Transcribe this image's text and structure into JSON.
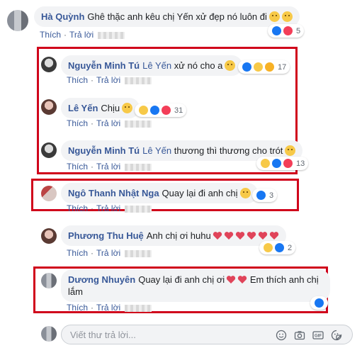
{
  "actions": {
    "like": "Thích",
    "reply": "Trả lời",
    "dot": "·"
  },
  "comments": [
    {
      "name": "Hà Quỳnh",
      "text": "Ghê thặc anh kêu chị Yến xử đẹp nó luôn đi",
      "reaction_count": "5"
    },
    {
      "name": "Nguyễn Minh Tú",
      "mention": "Lê Yến",
      "text": "xử nó cho a",
      "reaction_count": "17"
    },
    {
      "name": "Lê Yến",
      "text": "Chịu",
      "reaction_count": "31"
    },
    {
      "name": "Nguyễn Minh Tú",
      "mention": "Lê Yến",
      "text": "thương thì thương cho trót",
      "reaction_count": "13"
    },
    {
      "name": "Ngô Thanh Nhật Nga",
      "text": "Quay lại đi anh chị",
      "reaction_count": "3"
    },
    {
      "name": "Phương Thu Huệ",
      "text": "Anh chị ơi huhu",
      "reaction_count": "2"
    },
    {
      "name": "Dương Nhuyên",
      "text": "Quay lại đi anh chị ơi",
      "text_after": "Em thích anh chị lắm"
    }
  ],
  "reply_box": {
    "placeholder": "Viết thư trả lời..."
  },
  "icons": [
    "smile-icon",
    "camera-icon",
    "gif-icon",
    "sticker-icon"
  ],
  "colors": {
    "name": "#385898",
    "highlight": "#d0021b",
    "bubble": "#f2f3f5",
    "like": "#1877f2",
    "love": "#f33e58"
  }
}
